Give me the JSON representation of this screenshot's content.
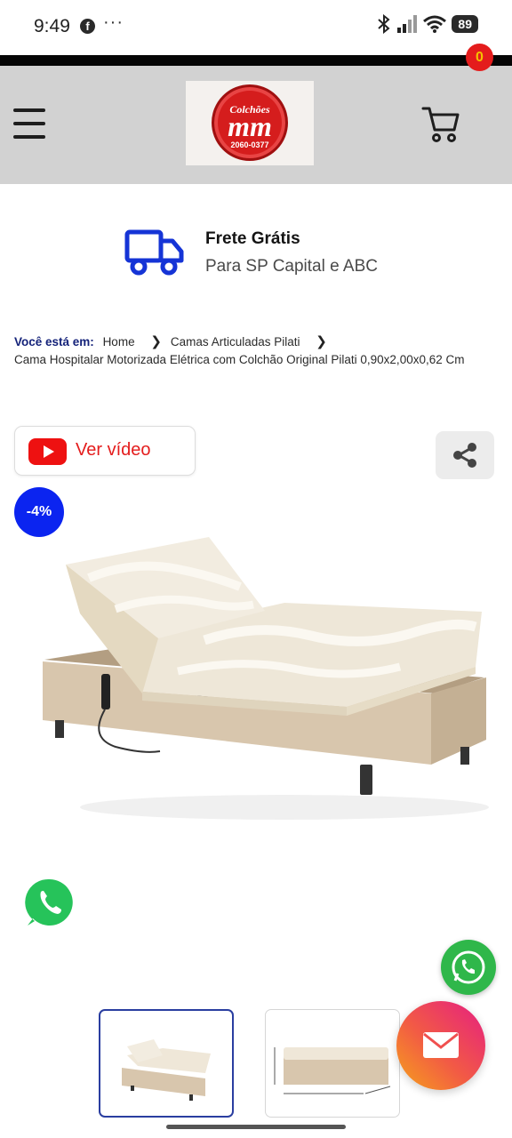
{
  "status_bar": {
    "time": "9:49",
    "more": "···",
    "battery": "89",
    "icons": [
      "facebook-icon",
      "bluetooth-icon",
      "signal-icon",
      "wifi-icon",
      "battery-icon"
    ]
  },
  "header": {
    "logo": {
      "top_text": "Colchões",
      "brand": "mm",
      "phone": "2060-0377"
    },
    "cart_count": "0"
  },
  "shipping": {
    "title": "Frete Grátis",
    "subtitle": "Para SP Capital e ABC"
  },
  "breadcrumb": {
    "label": "Você está em:",
    "items": [
      "Home",
      "Camas Articuladas Pilati"
    ],
    "current": "Cama Hospitalar Motorizada Elétrica com Colchão Original Pilati 0,90x2,00x0,62 Cm"
  },
  "video_button": {
    "label": "Ver vídeo"
  },
  "product": {
    "discount": "-4%"
  },
  "colors": {
    "header_bg": "#d2d2d2",
    "accent_blue": "#0b24f0",
    "accent_red": "#e41c1c",
    "whatsapp_green": "#2fb74a"
  }
}
